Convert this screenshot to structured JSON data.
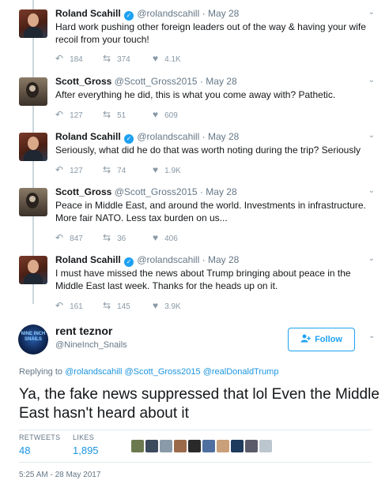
{
  "thread": [
    {
      "name": "Roland Scahill",
      "verified": true,
      "handle": "@rolandscahill",
      "date": "May 28",
      "text": "Hard work pushing other foreign leaders out of the way & having your wife recoil from your touch!",
      "replies": "184",
      "retweets": "374",
      "likes": "4.1K"
    },
    {
      "name": "Scott_Gross",
      "verified": false,
      "handle": "@Scott_Gross2015",
      "date": "May 28",
      "text": "After everything he did, this is what you come away with? Pathetic.",
      "replies": "127",
      "retweets": "51",
      "likes": "609"
    },
    {
      "name": "Roland Scahill",
      "verified": true,
      "handle": "@rolandscahill",
      "date": "May 28",
      "text": "Seriously, what did he do that was worth noting during the trip? Seriously",
      "replies": "127",
      "retweets": "74",
      "likes": "1.9K"
    },
    {
      "name": "Scott_Gross",
      "verified": false,
      "handle": "@Scott_Gross2015",
      "date": "May 28",
      "text": "Peace in Middle East, and around the world. Investments in infrastructure. More fair NATO. Less tax burden on us...",
      "replies": "847",
      "retweets": "36",
      "likes": "406"
    },
    {
      "name": "Roland Scahill",
      "verified": true,
      "handle": "@rolandscahill",
      "date": "May 28",
      "text": "I must have missed the news about Trump bringing about peace in the Middle East last week. Thanks for the heads up on it.",
      "replies": "161",
      "retweets": "145",
      "likes": "3.9K"
    }
  ],
  "main_tweet": {
    "name": "rent teznor",
    "handle": "@NineInch_Snails",
    "avatar_text": "NINE INCH SNAILS",
    "follow_label": "Follow",
    "replying_prefix": "Replying to",
    "replying_to": "@rolandscahill @Scott_Gross2015 @realDonaldTrump",
    "text": "Ya, the fake news suppressed that lol   Even the Middle East hasn't heard about it",
    "retweets_label": "RETWEETS",
    "retweets_value": "48",
    "likes_label": "LIKES",
    "likes_value": "1,895",
    "timestamp": "5:25 AM - 28 May 2017"
  },
  "icons": {
    "reply": "reply-icon",
    "retweet": "retweet-icon",
    "like": "heart-icon",
    "caret": "chevron-down-icon",
    "verified": "verified-badge-icon",
    "follow": "add-user-icon"
  },
  "colors": {
    "accent": "#1da1f2",
    "link": "#1b95e0",
    "muted": "#657786",
    "icon_gray": "#8899a6"
  },
  "liker_avatar_colors": [
    "#6b7a4e",
    "#3c4a5e",
    "#8a9aa8",
    "#9b6a4a",
    "#2a2a2a",
    "#4f6fa0",
    "#c9a07a",
    "#1e3a5c",
    "#5a5a6a",
    "#bcc6cf"
  ]
}
